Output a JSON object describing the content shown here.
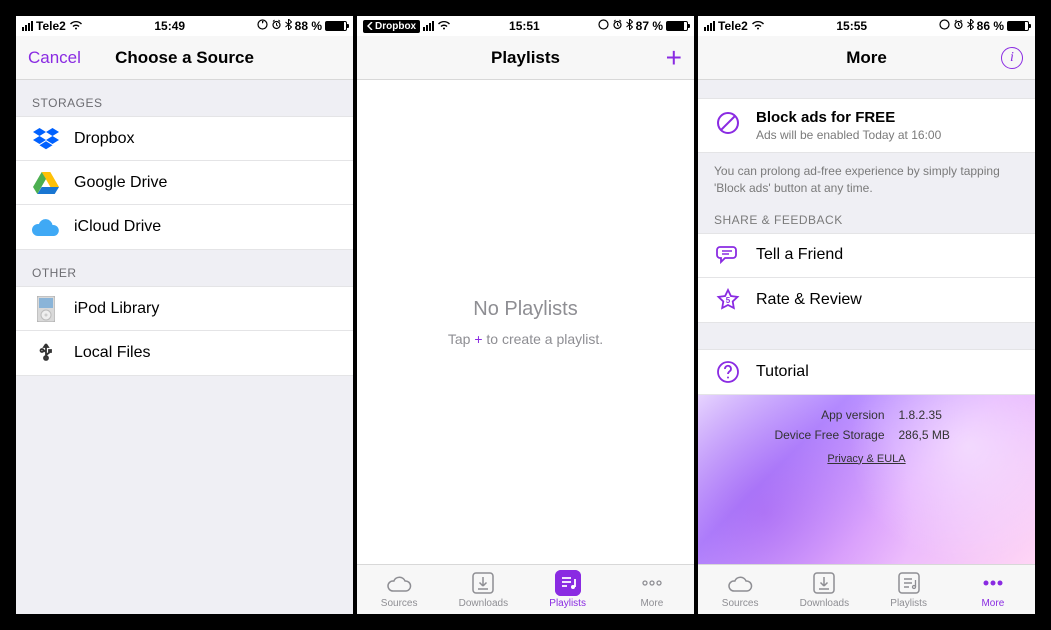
{
  "screen1": {
    "statusbar": {
      "carrier": "Tele2",
      "time": "15:49",
      "battery_pct": "88 %"
    },
    "nav": {
      "left": "Cancel",
      "title": "Choose a Source"
    },
    "sections": {
      "storages_header": "STORAGES",
      "storages": [
        {
          "name": "dropbox",
          "label": "Dropbox"
        },
        {
          "name": "google-drive",
          "label": "Google Drive"
        },
        {
          "name": "icloud-drive",
          "label": "iCloud Drive"
        }
      ],
      "other_header": "OTHER",
      "other": [
        {
          "name": "ipod-library",
          "label": "iPod Library"
        },
        {
          "name": "local-files",
          "label": "Local Files"
        }
      ]
    }
  },
  "screen2": {
    "statusbar": {
      "back": "Dropbox",
      "time": "15:51",
      "battery_pct": "87 %"
    },
    "nav": {
      "title": "Playlists",
      "right": "+"
    },
    "empty": {
      "title": "No Playlists",
      "pre": "Tap ",
      "plus": "+",
      "post": " to create a playlist."
    },
    "tabs": [
      {
        "name": "sources",
        "label": "Sources"
      },
      {
        "name": "downloads",
        "label": "Downloads"
      },
      {
        "name": "playlists",
        "label": "Playlists"
      },
      {
        "name": "more",
        "label": "More"
      }
    ],
    "active_tab": "playlists"
  },
  "screen3": {
    "statusbar": {
      "carrier": "Tele2",
      "time": "15:55",
      "battery_pct": "86 %"
    },
    "nav": {
      "title": "More"
    },
    "block_ads": {
      "label": "Block ads for FREE",
      "sub": "Ads will be enabled Today at 16:00"
    },
    "note": "You can prolong ad-free experience by simply tapping 'Block ads' button at any time.",
    "share_header": "SHARE & FEEDBACK",
    "items": {
      "tell": "Tell a Friend",
      "rate": "Rate & Review",
      "tutorial": "Tutorial"
    },
    "footer": {
      "app_version_k": "App version",
      "app_version_v": "1.8.2.35",
      "storage_k": "Device Free Storage",
      "storage_v": "286,5 MB",
      "link": "Privacy & EULA"
    },
    "tabs": [
      {
        "name": "sources",
        "label": "Sources"
      },
      {
        "name": "downloads",
        "label": "Downloads"
      },
      {
        "name": "playlists",
        "label": "Playlists"
      },
      {
        "name": "more",
        "label": "More"
      }
    ],
    "active_tab": "more"
  }
}
